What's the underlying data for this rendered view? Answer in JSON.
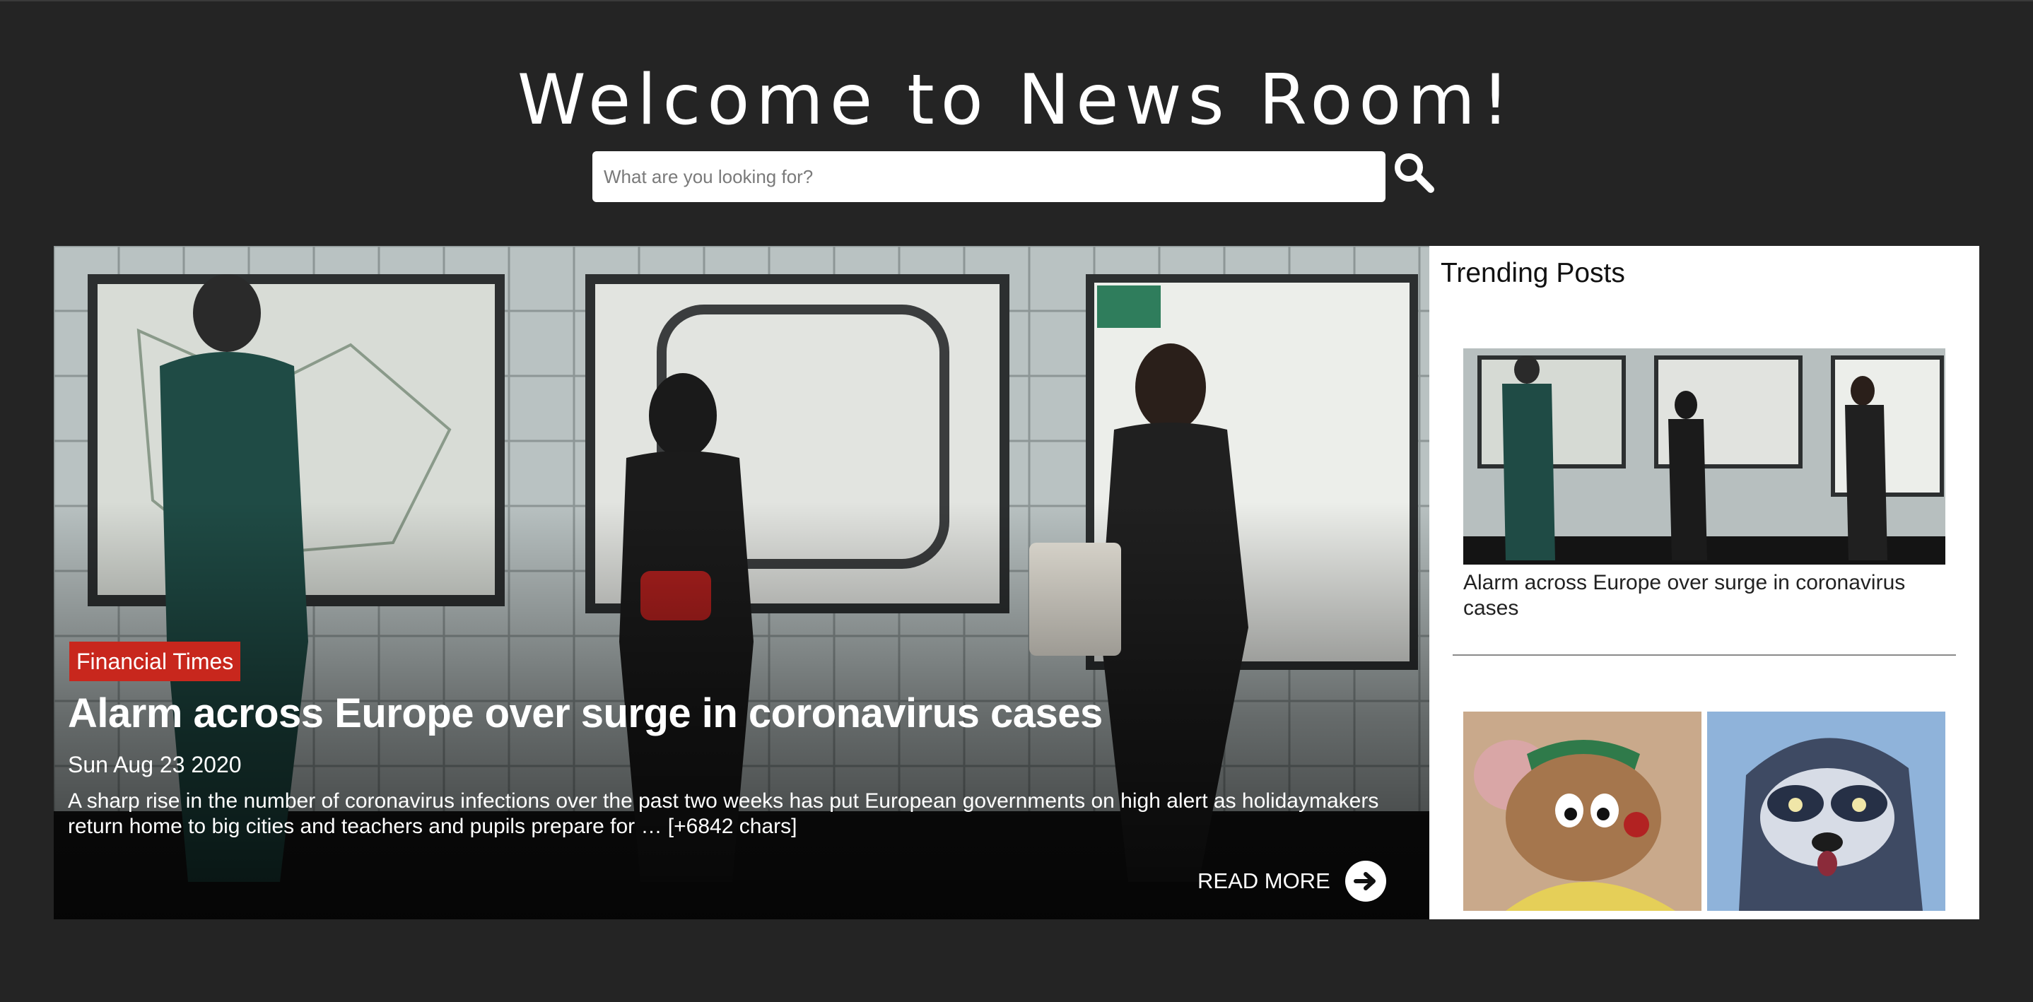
{
  "site": {
    "title": "Welcome to News Room!"
  },
  "search": {
    "placeholder": "What are you looking for?",
    "icon": "search-icon"
  },
  "featured": {
    "source": "Financial Times",
    "headline": "Alarm across Europe over surge in coronavirus cases",
    "date": "Sun Aug 23 2020",
    "description": "A sharp rise in the number of coronavirus infections over the past two weeks has put European governments on high alert as holidaymakers return home to big cities and teachers and pupils prepare for … [+6842 chars]",
    "read_more_label": "READ MORE",
    "read_more_icon": "arrow-right-circle-icon",
    "badge_color": "#c8271d"
  },
  "trending": {
    "title": "Trending Posts",
    "posts": [
      {
        "title": "Alarm across Europe over surge in coronavirus cases"
      },
      {
        "title": ""
      }
    ]
  },
  "colors": {
    "page_background": "#242424",
    "panel_background": "#ffffff"
  }
}
